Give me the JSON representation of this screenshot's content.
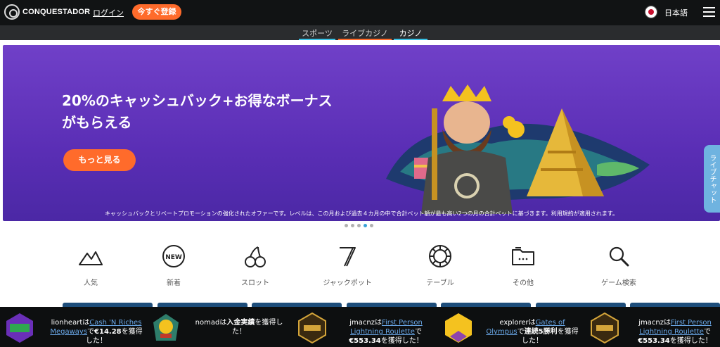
{
  "header": {
    "logo_text": "CONQUESTADOR",
    "login_label": "ログイン",
    "register_label": "今すぐ登録",
    "language_label": "日本語"
  },
  "subnav": {
    "sports": "スポーツ",
    "live_casino": "ライブカジノ",
    "casino": "カジノ"
  },
  "banner": {
    "title_line1": "20%のキャッシュバック+お得なボーナス",
    "title_line2": "がもらえる",
    "cta_label": "もっと見る",
    "note": "キャッシュバックとリベートプロモーションの強化されたオファーです。レベルは、この月および過去４カ月の中で合計ベット額が最も高い2つの月の合計ベットに基づきます。利用規約が適用されます。",
    "carousel_dots": 5,
    "active_dot": 3
  },
  "chat_tab": "ライブチャット",
  "categories": [
    {
      "label": "人気",
      "icon": "mountain-icon"
    },
    {
      "label": "新着",
      "icon": "new-badge-icon"
    },
    {
      "label": "スロット",
      "icon": "cherry-icon"
    },
    {
      "label": "ジャックポット",
      "icon": "seven-icon"
    },
    {
      "label": "テーブル",
      "icon": "chip-icon"
    },
    {
      "label": "その他",
      "icon": "folder-icon"
    },
    {
      "label": "ゲーム検索",
      "icon": "search-icon"
    }
  ],
  "ticker": [
    {
      "user": "lionheart",
      "pre": "は",
      "game": "Cash 'N Riches Megaways",
      "mid": "で",
      "amount": "€14.28",
      "post": "を獲得した！"
    },
    {
      "user": "nomad",
      "pre": "は",
      "game": "",
      "mid": "",
      "amount": "入金実績",
      "post": "を獲得した！"
    },
    {
      "user": "jmacnz",
      "pre": "は",
      "game": "First Person Lightning Roulette",
      "mid": "で",
      "amount": "€553.34",
      "post": "を獲得した！"
    },
    {
      "user": "explorer",
      "pre": "は",
      "game": "Gates of Olympus",
      "mid": "で",
      "amount": "連続5勝利",
      "post": "を獲得した！"
    },
    {
      "user": "jmacnz",
      "pre": "は",
      "game": "First Person Lightning Roulette",
      "mid": "で",
      "amount": "€553.34",
      "post": "を獲得した！"
    }
  ],
  "colors": {
    "accent_orange": "#ff6b2b",
    "banner_purple": "#6a3cc2",
    "link_blue": "#6aa8e8"
  }
}
